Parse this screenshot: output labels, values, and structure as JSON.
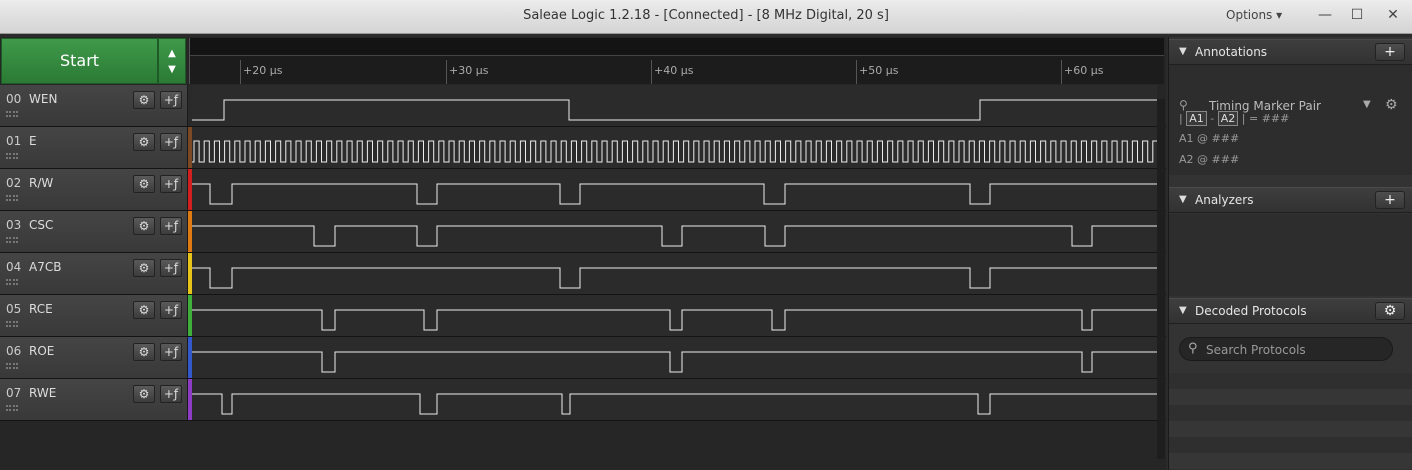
{
  "window": {
    "title": "Saleae Logic 1.2.18 - [Connected] - [8 MHz Digital, 20 s]",
    "options_label": "Options ▾",
    "minimize": "—",
    "maximize": "☐",
    "close": "✕"
  },
  "start_button": {
    "label": "Start",
    "up": "▲",
    "down": "▼"
  },
  "ruler": {
    "ticks": [
      "+20 µs",
      "+30 µs",
      "+40 µs",
      "+50 µs",
      "+60 µs"
    ]
  },
  "channels": [
    {
      "index": "00",
      "name": "WEN",
      "color": "#2a2a2a"
    },
    {
      "index": "01",
      "name": "E",
      "color": "#7b4a25"
    },
    {
      "index": "02",
      "name": "R/W",
      "color": "#d22020"
    },
    {
      "index": "03",
      "name": "CSC",
      "color": "#e07a12"
    },
    {
      "index": "04",
      "name": "A7CB",
      "color": "#e6c419"
    },
    {
      "index": "05",
      "name": "RCE",
      "color": "#3fae3a"
    },
    {
      "index": "06",
      "name": "ROE",
      "color": "#3258c9"
    },
    {
      "index": "07",
      "name": "RWE",
      "color": "#8e3cc4"
    }
  ],
  "channel_buttons": {
    "settings": "⚙",
    "trigger": "+ƒ"
  },
  "annotations": {
    "title": "Annotations",
    "add": "+",
    "marker_pair": "Timing Marker Pair",
    "measure": {
      "open": "|",
      "a1": "A1",
      "dash": "-",
      "a2": "A2",
      "close": "|",
      "eq": "= ###"
    },
    "a1_line": {
      "label": "A1",
      "at": "@",
      "value": "###"
    },
    "a2_line": {
      "label": "A2",
      "at": "@",
      "value": "###"
    }
  },
  "analyzers": {
    "title": "Analyzers",
    "add": "+"
  },
  "decoded_protocols": {
    "title": "Decoded Protocols",
    "search_placeholder": "Search Protocols"
  }
}
